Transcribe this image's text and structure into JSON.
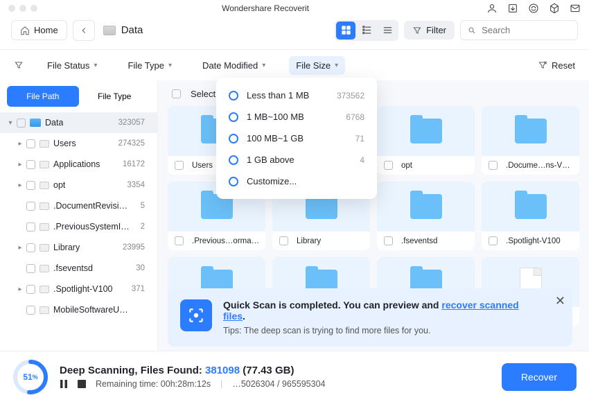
{
  "app_title": "Wondershare Recoverit",
  "topbar": {
    "home": "Home",
    "location": "Data",
    "filter_label": "Filter",
    "search_placeholder": "Search"
  },
  "filterbar": {
    "file_status": "File Status",
    "file_type": "File Type",
    "date_modified": "Date Modified",
    "file_size": "File Size",
    "reset": "Reset"
  },
  "size_dropdown": [
    {
      "label": "Less than 1 MB",
      "count": "373562"
    },
    {
      "label": "1 MB~100 MB",
      "count": "6768"
    },
    {
      "label": "100 MB~1 GB",
      "count": "71"
    },
    {
      "label": "1 GB above",
      "count": "4"
    },
    {
      "label": "Customize...",
      "count": ""
    }
  ],
  "sidebar": {
    "tabs": {
      "path": "File Path",
      "type": "File Type"
    },
    "tree": [
      {
        "label": "Data",
        "count": "323057",
        "indent": 0,
        "caret": "▾",
        "selected": true,
        "drive": true
      },
      {
        "label": "Users",
        "count": "274325",
        "indent": 1,
        "caret": "▸"
      },
      {
        "label": "Applications",
        "count": "16172",
        "indent": 1,
        "caret": "▸"
      },
      {
        "label": "opt",
        "count": "3354",
        "indent": 1,
        "caret": "▸"
      },
      {
        "label": ".DocumentRevisions-…",
        "count": "5",
        "indent": 1,
        "caret": ""
      },
      {
        "label": ".PreviousSystemInfor…",
        "count": "2",
        "indent": 1,
        "caret": ""
      },
      {
        "label": "Library",
        "count": "23995",
        "indent": 1,
        "caret": "▸"
      },
      {
        "label": ".fseventsd",
        "count": "30",
        "indent": 1,
        "caret": ""
      },
      {
        "label": ".Spotlight-V100",
        "count": "371",
        "indent": 1,
        "caret": "▸"
      },
      {
        "label": "MobileSoftwareUpdate",
        "count": "",
        "indent": 1,
        "caret": ""
      }
    ]
  },
  "grid": {
    "select_all": "Select All",
    "tiles": [
      {
        "label": "Users",
        "type": "folder"
      },
      {
        "label": "",
        "type": "folder"
      },
      {
        "label": "opt",
        "type": "folder"
      },
      {
        "label": ".Docume…ns-V100",
        "type": "folder"
      },
      {
        "label": ".Previous…ormation",
        "type": "folder"
      },
      {
        "label": "Library",
        "type": "folder"
      },
      {
        "label": ".fseventsd",
        "type": "folder"
      },
      {
        "label": ".Spotlight-V100",
        "type": "folder"
      },
      {
        "label": "",
        "type": "folder"
      },
      {
        "label": "",
        "type": "folder"
      },
      {
        "label": "",
        "type": "folder"
      },
      {
        "label": "",
        "type": "file"
      }
    ]
  },
  "toast": {
    "title_pre": "Quick Scan is completed. You can preview and ",
    "title_link": "recover scanned files",
    "title_post": ".",
    "tip": "Tips: The deep scan is trying to find more files for you."
  },
  "footer": {
    "percent": "51",
    "title_pre": "Deep Scanning, Files Found: ",
    "found": "381098",
    "size": " (77.43 GB)",
    "remaining_label": "Remaining time: ",
    "remaining": "00h:28m:12s",
    "sectors": "…5026304 / 965595304",
    "recover": "Recover"
  }
}
